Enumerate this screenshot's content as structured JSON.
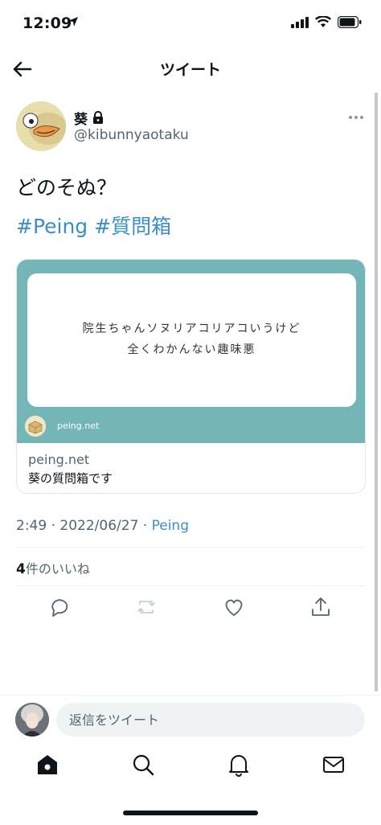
{
  "status": {
    "time": "12:09"
  },
  "nav": {
    "title": "ツイート"
  },
  "tweet": {
    "user_name": "葵",
    "handle": "@kibunnyaotaku",
    "text": "どのそぬ？",
    "hashtags": [
      "#Peing",
      "#質問箱"
    ],
    "card": {
      "question_line1": "院生ちゃんソヌリアコリアコいうけど",
      "question_line2": "全くわかんない趣味悪",
      "site_label": "peing.net",
      "domain": "peing.net",
      "description": "葵の質問箱です"
    },
    "meta": {
      "time": "2:49",
      "date": "2022/06/27",
      "source": "Peing",
      "sep": " · "
    },
    "likes": {
      "count": "4",
      "label": "件のいいね"
    }
  },
  "reply": {
    "placeholder": "返信をツイート"
  },
  "icons": {
    "back": "back-arrow-icon",
    "more": "more-dots-icon",
    "lock": "lock-icon",
    "reply": "reply-icon",
    "retweet": "retweet-icon",
    "like": "heart-icon",
    "share": "share-icon",
    "home": "home-icon",
    "search": "search-icon",
    "notifications": "bell-icon",
    "messages": "envelope-icon"
  },
  "colors": {
    "accent": "#1d9bf0",
    "card_bg": "#74b5b8",
    "text": "#0f1419",
    "muted": "#536471"
  }
}
